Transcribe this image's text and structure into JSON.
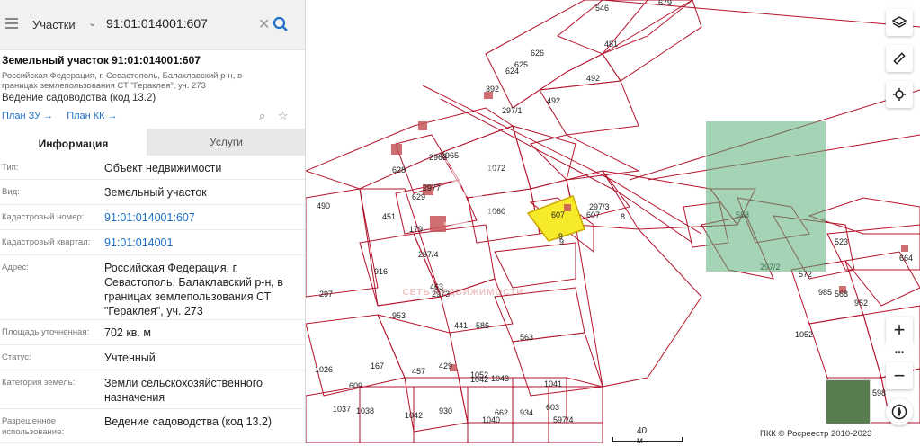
{
  "search": {
    "category": "Участки",
    "query": "91:01:014001:607",
    "clear_icon": "✕",
    "search_icon": "search-icon"
  },
  "panel": {
    "title": "Земельный участок 91:01:014001:607",
    "address_short": "Российская Федерация, г. Севастополь, Балаклавский р-н, в границах землепользования СТ \"Гераклея\", уч. 273",
    "purpose_short": "Ведение садоводства (код 13.2)",
    "links": [
      "План ЗУ →",
      "План КК →"
    ],
    "tabs": [
      "Информация",
      "Услуги"
    ],
    "active_tab": "Информация"
  },
  "info_rows": [
    {
      "key": "Тип:",
      "value": "Объект недвижимости",
      "link": false
    },
    {
      "key": "Вид:",
      "value": "Земельный участок",
      "link": false
    },
    {
      "key": "Кадастровый номер:",
      "value": "91:01:014001:607",
      "link": true
    },
    {
      "key": "Кадастровый квартал:",
      "value": "91:01:014001",
      "link": true
    },
    {
      "key": "Адрес:",
      "value": "Российская Федерация, г. Севастополь, Балаклавский р-н, в границах землепользования СТ \"Гераклея\", уч. 273",
      "link": false
    },
    {
      "key": "Площадь уточненная:",
      "value": "702 кв. м",
      "link": false
    },
    {
      "key": "Статус:",
      "value": "Учтенный",
      "link": false
    },
    {
      "key": "Категория земель:",
      "value": "Земли сельскохозяйственного назначения",
      "link": false
    },
    {
      "key": "Разрешенное использование:",
      "value": "Ведение садоводства (код 13.2)",
      "link": false
    }
  ],
  "map": {
    "parcel_labels": [
      "546",
      "679",
      "481",
      "626",
      "625",
      "624",
      "492",
      "392",
      "297/1",
      "492",
      "1072",
      "628",
      "629",
      "451",
      "1060",
      "8",
      "588",
      "490",
      "179",
      "297/4",
      "9",
      "523",
      "664",
      "916",
      "297",
      "297/2",
      "572",
      "985",
      "568",
      "952",
      "953",
      "441",
      "1052",
      "563",
      "1026",
      "167",
      "457",
      "429",
      "1042",
      "1043",
      "1041",
      "603",
      "609",
      "1037",
      "1038",
      "1042",
      "930",
      "1040",
      "934",
      "662",
      "597/4",
      "598",
      "607",
      "607",
      "9",
      "297/3",
      "2963",
      "2965",
      "2977",
      "1052",
      "586",
      "463",
      "2973",
      "1065"
    ],
    "highlight_parcel": "607",
    "highlight_color": "#f6ea2a",
    "line_color": "#b3122b",
    "scale_label": "40 м",
    "copyright": "ПКК © Росреестр 2010-2023",
    "controls": [
      "layers-icon",
      "ruler-icon",
      "locate-icon"
    ],
    "zoom_in": "+",
    "zoom_more": "•••",
    "zoom_out": "−",
    "watermark_text": "СЕТЬ НЕДВИЖИМОСТИ",
    "watermark_letter": "R"
  }
}
